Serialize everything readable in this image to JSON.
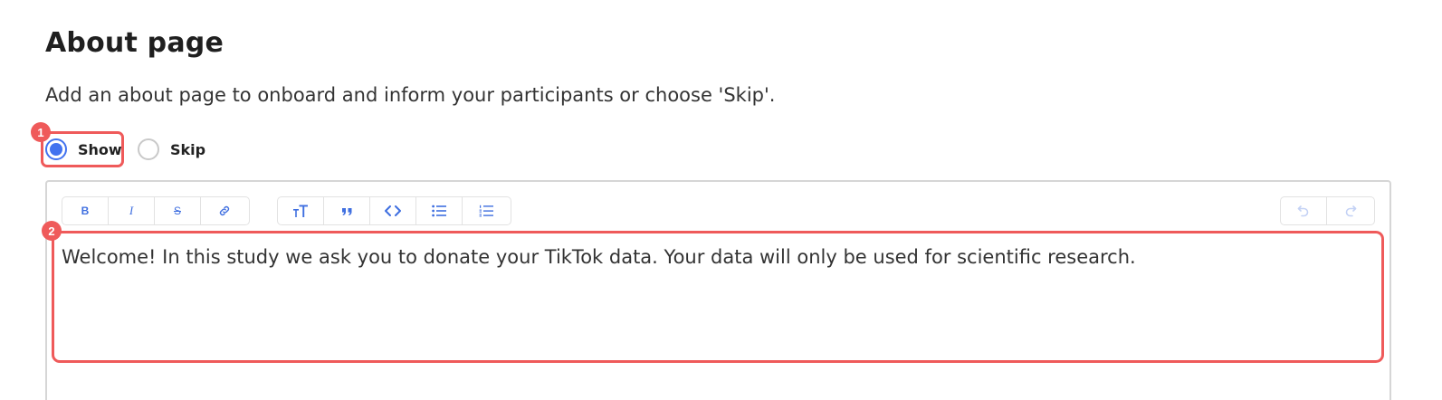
{
  "page": {
    "title": "About page",
    "description": "Add an about page to onboard and inform your participants or choose 'Skip'."
  },
  "visibility": {
    "options": [
      {
        "label": "Show",
        "checked": true
      },
      {
        "label": "Skip",
        "checked": false
      }
    ]
  },
  "editor": {
    "toolbar": {
      "format_group": [
        {
          "name": "bold",
          "glyph": "B"
        },
        {
          "name": "italic",
          "glyph": "I"
        },
        {
          "name": "strikethrough",
          "glyph": "S"
        },
        {
          "name": "link",
          "icon": "link-icon"
        }
      ],
      "block_group": [
        {
          "name": "heading",
          "icon": "text-size-icon"
        },
        {
          "name": "blockquote",
          "icon": "quote-icon"
        },
        {
          "name": "code",
          "icon": "code-icon"
        },
        {
          "name": "bullet-list",
          "icon": "bullet-list-icon"
        },
        {
          "name": "ordered-list",
          "icon": "ordered-list-icon"
        }
      ],
      "history_group": [
        {
          "name": "undo",
          "icon": "undo-icon",
          "enabled": false
        },
        {
          "name": "redo",
          "icon": "redo-icon",
          "enabled": false
        }
      ]
    },
    "content": "Welcome! In this study we ask you to donate your TikTok data. Your data will only be used for scientific research."
  },
  "annotations": [
    {
      "label": "1"
    },
    {
      "label": "2"
    }
  ],
  "colors": {
    "accent": "#4272ef",
    "toolbar_icon": "#3f6fe0",
    "annotation": "#ef5a5a",
    "border": "#d6d6d6"
  }
}
